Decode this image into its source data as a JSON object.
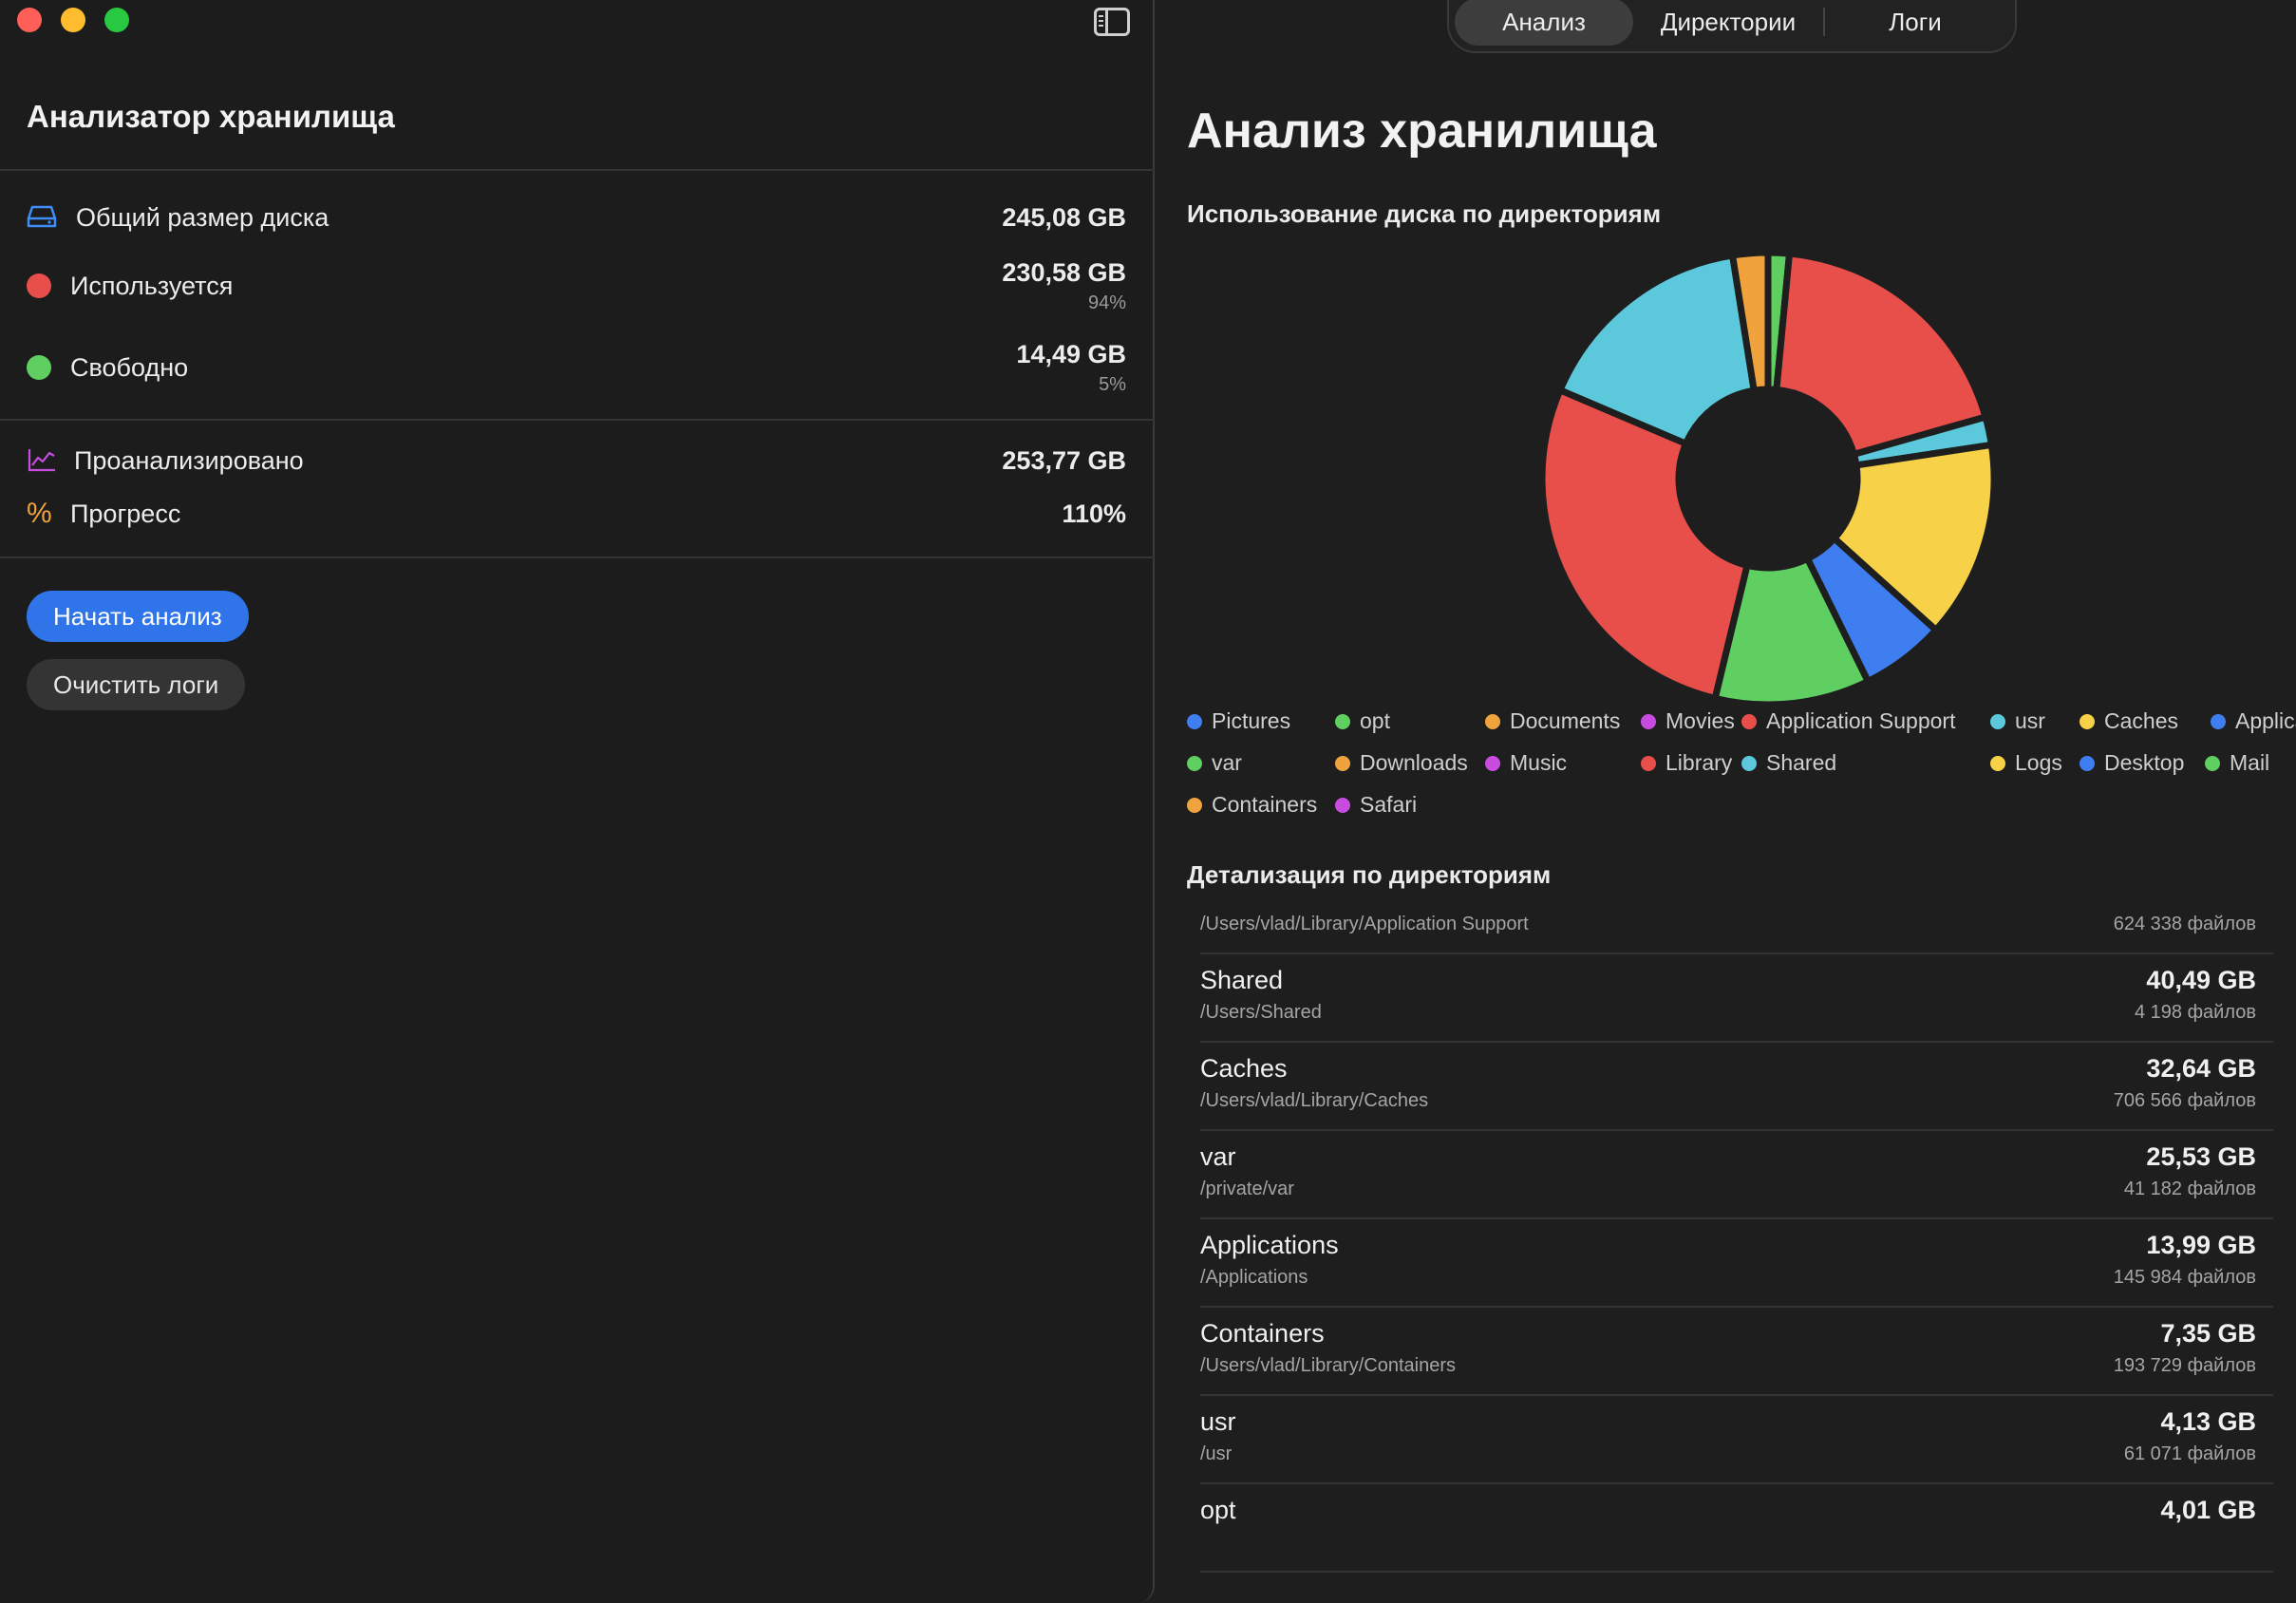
{
  "sidebar": {
    "title": "Анализатор хранилища",
    "stats": {
      "disk_total": {
        "label": "Общий размер диска",
        "value": "245,08 GB",
        "icon": "drive-icon"
      },
      "used": {
        "label": "Используется",
        "value": "230,58 GB",
        "percent": "94%",
        "color": "#e94f4a"
      },
      "free": {
        "label": "Свободно",
        "value": "14,49 GB",
        "percent": "5%",
        "color": "#5fcf62"
      },
      "analyzed": {
        "label": "Проанализировано",
        "value": "253,77 GB",
        "icon": "chart-line-icon"
      },
      "progress": {
        "label": "Прогресс",
        "value": "110%",
        "icon": "percent-icon"
      }
    },
    "buttons": {
      "start": "Начать анализ",
      "clear": "Очистить логи"
    }
  },
  "tabs": [
    {
      "label": "Анализ",
      "active": true
    },
    {
      "label": "Директории",
      "active": false
    },
    {
      "label": "Логи",
      "active": false
    }
  ],
  "main": {
    "title": "Анализ хранилища",
    "chart_section_title": "Использование диска по директориям",
    "detail_section_title": "Детализация по директориям"
  },
  "chart_data": {
    "type": "pie",
    "donut": true,
    "slices": [
      {
        "value": 1.5,
        "color": "#5fcf62"
      },
      {
        "value": 19.0,
        "color": "#e94f4a"
      },
      {
        "value": 2.0,
        "color": "#5bc9db"
      },
      {
        "value": 14.0,
        "color": "#f7d148"
      },
      {
        "value": 6.0,
        "color": "#3f7ef0"
      },
      {
        "value": 11.0,
        "color": "#5fcf62"
      },
      {
        "value": 27.5,
        "color": "#e94f4a"
      },
      {
        "value": 16.0,
        "color": "#5bc9db"
      },
      {
        "value": 2.5,
        "color": "#f0a33c"
      }
    ],
    "legend": [
      {
        "name": "Pictures",
        "color": "#3f7ef0"
      },
      {
        "name": "opt",
        "color": "#5fcf62"
      },
      {
        "name": "Documents",
        "color": "#f0a33c"
      },
      {
        "name": "Movies",
        "color": "#c84ce0"
      },
      {
        "name": "Application Support",
        "color": "#e94f4a"
      },
      {
        "name": "usr",
        "color": "#5bc9db"
      },
      {
        "name": "Caches",
        "color": "#f7d148"
      },
      {
        "name": "Applica",
        "color": "#3f7ef0"
      },
      {
        "name": "var",
        "color": "#5fcf62"
      },
      {
        "name": "Downloads",
        "color": "#f0a33c"
      },
      {
        "name": "Music",
        "color": "#c84ce0"
      },
      {
        "name": "Library",
        "color": "#e94f4a"
      },
      {
        "name": "Shared",
        "color": "#5bc9db"
      },
      {
        "name": "Logs",
        "color": "#f7d148"
      },
      {
        "name": "Desktop",
        "color": "#3f7ef0"
      },
      {
        "name": "Mail",
        "color": "#5fcf62"
      },
      {
        "name": "Containers",
        "color": "#f0a33c"
      },
      {
        "name": "Safari",
        "color": "#c84ce0"
      }
    ]
  },
  "directories": [
    {
      "name": "",
      "path": "/Users/vlad/Library/Application Support",
      "size": "",
      "files": "624 338 файлов"
    },
    {
      "name": "Shared",
      "path": "/Users/Shared",
      "size": "40,49 GB",
      "files": "4 198 файлов"
    },
    {
      "name": "Caches",
      "path": "/Users/vlad/Library/Caches",
      "size": "32,64 GB",
      "files": "706 566 файлов"
    },
    {
      "name": "var",
      "path": "/private/var",
      "size": "25,53 GB",
      "files": "41 182 файлов"
    },
    {
      "name": "Applications",
      "path": "/Applications",
      "size": "13,99 GB",
      "files": "145 984 файлов"
    },
    {
      "name": "Containers",
      "path": "/Users/vlad/Library/Containers",
      "size": "7,35 GB",
      "files": "193 729 файлов"
    },
    {
      "name": "usr",
      "path": "/usr",
      "size": "4,13 GB",
      "files": "61 071 файлов"
    },
    {
      "name": "opt",
      "path": "",
      "size": "4,01 GB",
      "files": ""
    }
  ]
}
